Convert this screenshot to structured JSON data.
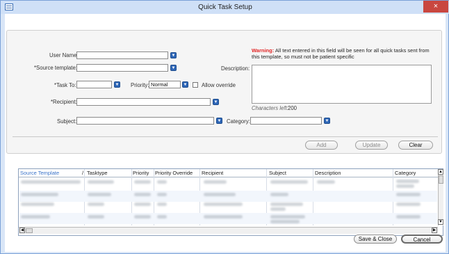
{
  "window": {
    "title": "Quick Task Setup",
    "close_symbol": "×"
  },
  "warning": {
    "label": "Warning:",
    "text": "All text entered in this field will be seen for all quick tasks sent from this template, so must not be patient specific"
  },
  "form": {
    "user_name_label": "User Name:",
    "source_template_label": "*Source template:",
    "task_to_label": "*Task To:",
    "priority_label": "Priority:",
    "priority_value": "Normal",
    "allow_override_label": "Allow override",
    "recipient_label": "*Recipient:",
    "subject_label": "Subject:",
    "description_label": "Description:",
    "chars_left_label": "Characters left:",
    "chars_left_value": "200",
    "category_label": "Category:"
  },
  "actions": {
    "add": "Add",
    "update": "Update",
    "clear": "Clear"
  },
  "grid": {
    "headers": [
      "Source Template",
      "/",
      "Tasktype",
      "Priority",
      "Priority Override",
      "Recipient",
      "Subject",
      "Description",
      "Category"
    ]
  },
  "footer": {
    "save_close": "Save & Close",
    "cancel": "Cancel"
  },
  "icons": {
    "dropdown": "chevron-down-icon",
    "checkbox": "checkbox-icon"
  },
  "colors": {
    "accent": "#2f67b7",
    "warning": "#e12323",
    "window": "#d9e6f7"
  }
}
